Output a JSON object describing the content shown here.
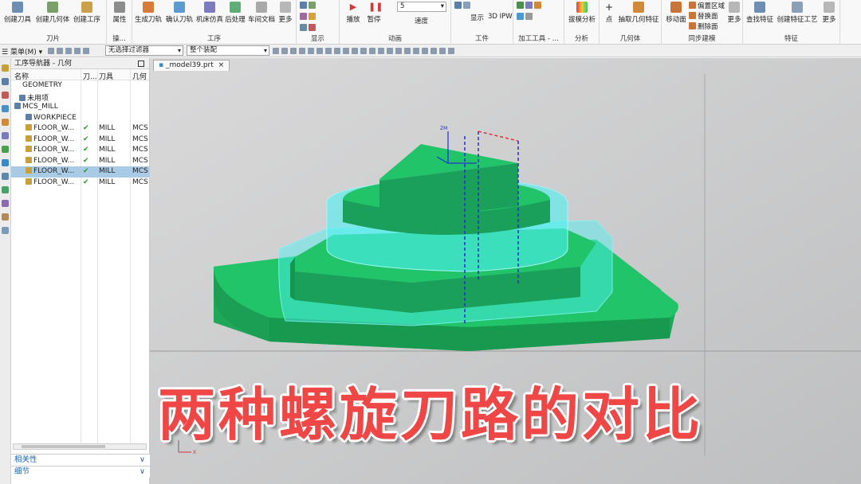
{
  "ribbon": {
    "knife": {
      "label": "刀片",
      "buttons": [
        "创建刀具",
        "创建几何体",
        "创建工序"
      ]
    },
    "ops": {
      "label": "操...",
      "buttons": [
        "属性"
      ]
    },
    "process": {
      "label": "工序",
      "buttons": [
        "生成刀轨",
        "确认刀轨",
        "机床仿真",
        "后处理",
        "车间文档",
        "更多"
      ]
    },
    "display": {
      "label": "显示"
    },
    "anim": {
      "label": "动画",
      "buttons": [
        "播放",
        "暂停"
      ],
      "speed_value": "5",
      "speed_label": "速度"
    },
    "workpiece": {
      "label": "工件",
      "buttons": [
        "显示",
        "3D IPW"
      ]
    },
    "machtools": {
      "label": "加工工具 - ..."
    },
    "analysis": {
      "label": "分析",
      "buttons": [
        "拔模分析"
      ]
    },
    "geombody": {
      "label": "几何体",
      "buttons": [
        "点",
        "抽取几何特征"
      ]
    },
    "sync": {
      "label": "同步建模",
      "buttons": [
        "移动面",
        "更多"
      ],
      "small": [
        "偏置区域",
        "替换面",
        "删除面"
      ]
    },
    "feature": {
      "label": "特征",
      "buttons": [
        "查找特征",
        "创建特征工艺",
        "更多"
      ]
    }
  },
  "toolbar2": {
    "menu_label": "菜单(M)",
    "filter_value": "无选择过滤器",
    "assembly_value": "整个装配"
  },
  "navigator": {
    "title": "工序导航器 - 几何",
    "columns": [
      "名称",
      "刀...",
      "刀具",
      "几何"
    ],
    "rows": [
      {
        "name": "GEOMETRY",
        "check": "",
        "tool": "",
        "geom": ""
      },
      {
        "name": "未用项",
        "check": "",
        "tool": "",
        "geom": ""
      },
      {
        "name": "MCS_MILL",
        "check": "",
        "tool": "",
        "geom": ""
      },
      {
        "name": "WORKPIECE",
        "check": "",
        "tool": "",
        "geom": ""
      },
      {
        "name": "FLOOR_W...",
        "check": "✔",
        "tool": "MILL",
        "geom": "MCS"
      },
      {
        "name": "FLOOR_W...",
        "check": "✔",
        "tool": "MILL",
        "geom": "MCS"
      },
      {
        "name": "FLOOR_W...",
        "check": "✔",
        "tool": "MILL",
        "geom": "MCS"
      },
      {
        "name": "FLOOR_W...",
        "check": "✔",
        "tool": "MILL",
        "geom": "MCS"
      },
      {
        "name": "FLOOR_W...",
        "check": "✔",
        "tool": "MILL",
        "geom": "MCS"
      },
      {
        "name": "FLOOR_W...",
        "check": "✔",
        "tool": "MILL",
        "geom": "MCS"
      }
    ],
    "selected_row": 8,
    "sections": [
      "相关性",
      "细节"
    ]
  },
  "graphics": {
    "tab_label": "_model39.prt",
    "axis_label": "ZM",
    "triad_label": "X"
  },
  "banner_text": "两种螺旋刀路的对比",
  "colors": {
    "part_green": "#22c46a",
    "toolpath_cyan": "#4ef1f1",
    "banner_red": "#ef4646",
    "selection_blue": "#a9cbe6"
  }
}
